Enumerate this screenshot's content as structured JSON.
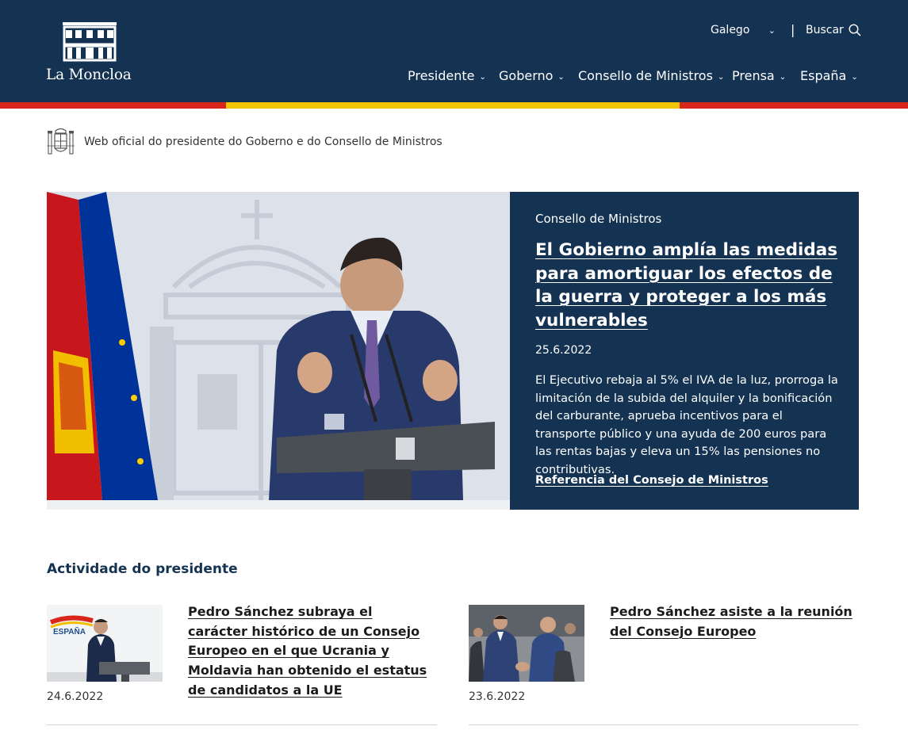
{
  "header": {
    "logo_text": "La Moncloa",
    "language": {
      "selected": "Galego"
    },
    "search_label": "Buscar",
    "nav": [
      {
        "label": "Presidente"
      },
      {
        "label": "Goberno"
      },
      {
        "label": "Consello de Ministros"
      },
      {
        "label": "Prensa"
      },
      {
        "label": "España"
      }
    ]
  },
  "tagline": "Web oficial do presidente do Goberno e do Consello de Ministros",
  "hero": {
    "category": "Consello de Ministros",
    "title": "El Gobierno amplía las medidas para amortiguar los efectos de la guerra y proteger a los más vulnerables",
    "date": "25.6.2022",
    "summary": "El Ejecutivo rebaja al 5% el IVA de la luz, prorroga la limitación de la subida del alquiler y la bonificación del carburante, aprueba incentivos para el transporte público y una ayuda de 200 euros para las rentas bajas y eleva un 15% las pensiones no contributivas.",
    "link": "Referencia del Consejo de Ministros"
  },
  "activity": {
    "title": "Actividade do presidente",
    "items": [
      {
        "title": "Pedro Sánchez subraya el carácter histórico de un Consejo Europeo en el que Ucrania y Moldavia han obtenido el estatus de candidatos a la UE",
        "date": "24.6.2022",
        "thumb_text": "ESPAÑA"
      },
      {
        "title": "Pedro Sánchez asiste a la reunión del Consejo Europeo",
        "date": "23.6.2022"
      }
    ]
  },
  "colors": {
    "navy": "#143252",
    "flag_red": "#d9261c",
    "flag_yellow": "#f2c500"
  },
  "icons": {
    "logo": "moncloa-palace-icon",
    "coat_of_arms": "coat-of-arms-icon",
    "search": "search-icon",
    "chevron": "chevron-down-icon"
  }
}
